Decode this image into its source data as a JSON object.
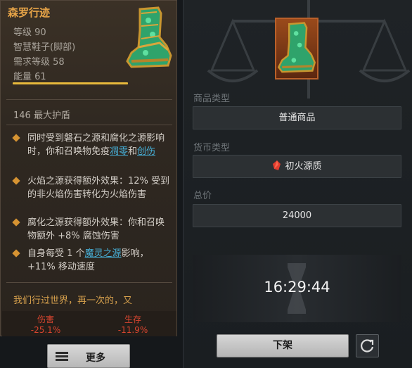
{
  "item": {
    "name": "森罗行迹",
    "grade": "等级 90",
    "type": "智慧鞋子(脚部)",
    "req_level": "需求等级 58",
    "energy": "能量 61",
    "armor": "146 最大护盾",
    "affix1_a": "同时受到磐石之源和腐化之源影响时，你和召唤物免疫",
    "affix1_link1": "凋零",
    "affix1_and": "和",
    "affix1_link2": "创伤",
    "affix2": "火焰之源获得额外效果：12% 受到的非火焰伤害转化为火焰伤害",
    "affix3": "腐化之源获得额外效果：你和召唤物额外 +8% 腐蚀伤害",
    "affix4_a": "自身每受 1 个",
    "affix4_link": "魔灵之源",
    "affix4_b": "影响，+11% 移动速度",
    "flavor": "我们行过世界，再一次的，又",
    "stat_damage_label": "伤害",
    "stat_damage_value": "-25.1%",
    "stat_survive_label": "生存",
    "stat_survive_value": "-11.9%",
    "icon": "boot-icon"
  },
  "more_button": {
    "label": "更多",
    "icon": "menu-icon"
  },
  "listing": {
    "type_label": "商品类型",
    "type_value": "普通商品",
    "currency_label": "货币类型",
    "currency_value": "初火源质",
    "currency_icon": "red-crystal-icon",
    "price_label": "总价",
    "price_value": "24000",
    "timer": "16:29:44",
    "delist_label": "下架",
    "refresh_icon": "refresh-icon"
  },
  "colors": {
    "title": "#e8a548",
    "link": "#47b0d8",
    "negative": "#d8452f",
    "flavor": "#d7a14d"
  }
}
